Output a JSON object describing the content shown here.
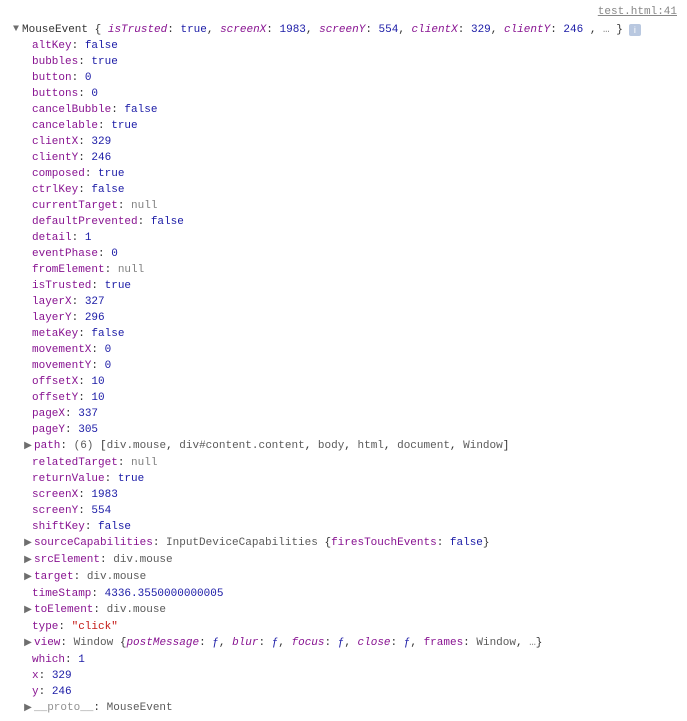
{
  "source_link": "test.html:41",
  "header": {
    "classname": "MouseEvent",
    "preview": [
      {
        "k": "isTrusted",
        "v": "true",
        "t": "blue",
        "ki": true
      },
      {
        "k": "screenX",
        "v": "1983",
        "t": "blue",
        "ki": true
      },
      {
        "k": "screenY",
        "v": "554",
        "t": "blue",
        "ki": true
      },
      {
        "k": "clientX",
        "v": "329",
        "t": "blue",
        "ki": true
      },
      {
        "k": "clientY",
        "v": "246",
        "t": "blue",
        "ki": true
      }
    ],
    "ellipsis": "…",
    "info": "i"
  },
  "props": [
    {
      "k": "altKey",
      "v": "false",
      "t": "blue"
    },
    {
      "k": "bubbles",
      "v": "true",
      "t": "blue"
    },
    {
      "k": "button",
      "v": "0",
      "t": "blue"
    },
    {
      "k": "buttons",
      "v": "0",
      "t": "blue"
    },
    {
      "k": "cancelBubble",
      "v": "false",
      "t": "blue"
    },
    {
      "k": "cancelable",
      "v": "true",
      "t": "blue"
    },
    {
      "k": "clientX",
      "v": "329",
      "t": "blue"
    },
    {
      "k": "clientY",
      "v": "246",
      "t": "blue"
    },
    {
      "k": "composed",
      "v": "true",
      "t": "blue"
    },
    {
      "k": "ctrlKey",
      "v": "false",
      "t": "blue"
    },
    {
      "k": "currentTarget",
      "v": "null",
      "t": "null"
    },
    {
      "k": "defaultPrevented",
      "v": "false",
      "t": "blue"
    },
    {
      "k": "detail",
      "v": "1",
      "t": "blue"
    },
    {
      "k": "eventPhase",
      "v": "0",
      "t": "blue"
    },
    {
      "k": "fromElement",
      "v": "null",
      "t": "null"
    },
    {
      "k": "isTrusted",
      "v": "true",
      "t": "blue"
    },
    {
      "k": "layerX",
      "v": "327",
      "t": "blue"
    },
    {
      "k": "layerY",
      "v": "296",
      "t": "blue"
    },
    {
      "k": "metaKey",
      "v": "false",
      "t": "blue"
    },
    {
      "k": "movementX",
      "v": "0",
      "t": "blue"
    },
    {
      "k": "movementY",
      "v": "0",
      "t": "blue"
    },
    {
      "k": "offsetX",
      "v": "10",
      "t": "blue"
    },
    {
      "k": "offsetY",
      "v": "10",
      "t": "blue"
    },
    {
      "k": "pageX",
      "v": "337",
      "t": "blue"
    },
    {
      "k": "pageY",
      "v": "305",
      "t": "blue"
    },
    {
      "k": "path",
      "expandable": true,
      "count": "(6)",
      "arr": [
        "div.mouse",
        "div#content.content",
        "body",
        "html",
        "document",
        "Window"
      ]
    },
    {
      "k": "relatedTarget",
      "v": "null",
      "t": "null"
    },
    {
      "k": "returnValue",
      "v": "true",
      "t": "blue"
    },
    {
      "k": "screenX",
      "v": "1983",
      "t": "blue"
    },
    {
      "k": "screenY",
      "v": "554",
      "t": "blue"
    },
    {
      "k": "shiftKey",
      "v": "false",
      "t": "blue"
    },
    {
      "k": "sourceCapabilities",
      "expandable": true,
      "obj_name": "InputDeviceCapabilities",
      "obj_kv": [
        {
          "k": "firesTouchEvents",
          "v": "false",
          "t": "blue"
        }
      ]
    },
    {
      "k": "srcElement",
      "expandable": true,
      "valtext": "div.mouse"
    },
    {
      "k": "target",
      "expandable": true,
      "valtext": "div.mouse"
    },
    {
      "k": "timeStamp",
      "v": "4336.3550000000005",
      "t": "blue"
    },
    {
      "k": "toElement",
      "expandable": true,
      "valtext": "div.mouse"
    },
    {
      "k": "type",
      "v": "\"click\"",
      "t": "string"
    },
    {
      "k": "view",
      "expandable": true,
      "obj_name": "Window",
      "obj_kv": [
        {
          "k": "postMessage",
          "v": "ƒ",
          "t": "blue",
          "ki": true
        },
        {
          "k": "blur",
          "v": "ƒ",
          "t": "blue",
          "ki": true
        },
        {
          "k": "focus",
          "v": "ƒ",
          "t": "blue",
          "ki": true
        },
        {
          "k": "close",
          "v": "ƒ",
          "t": "blue",
          "ki": true
        },
        {
          "k": "frames",
          "v": "Window",
          "t": "gray"
        }
      ],
      "ellipsis": "…"
    },
    {
      "k": "which",
      "v": "1",
      "t": "blue"
    },
    {
      "k": "x",
      "v": "329",
      "t": "blue"
    },
    {
      "k": "y",
      "v": "246",
      "t": "blue"
    },
    {
      "k": "__proto__",
      "expandable": true,
      "valtext": "MouseEvent",
      "dim": true
    }
  ]
}
